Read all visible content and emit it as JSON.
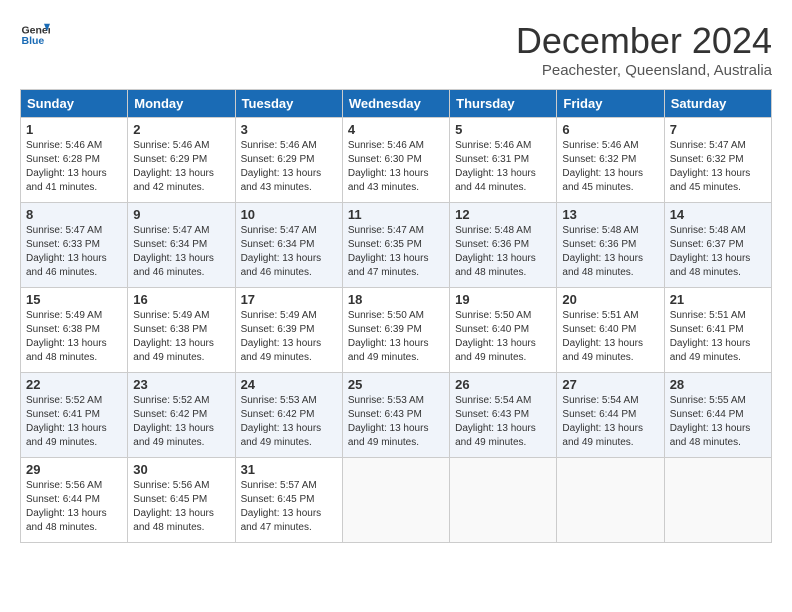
{
  "header": {
    "logo_line1": "General",
    "logo_line2": "Blue",
    "title": "December 2024",
    "location": "Peachester, Queensland, Australia"
  },
  "weekdays": [
    "Sunday",
    "Monday",
    "Tuesday",
    "Wednesday",
    "Thursday",
    "Friday",
    "Saturday"
  ],
  "weeks": [
    [
      {
        "day": "1",
        "sunrise": "5:46 AM",
        "sunset": "6:28 PM",
        "daylight": "13 hours and 41 minutes."
      },
      {
        "day": "2",
        "sunrise": "5:46 AM",
        "sunset": "6:29 PM",
        "daylight": "13 hours and 42 minutes."
      },
      {
        "day": "3",
        "sunrise": "5:46 AM",
        "sunset": "6:29 PM",
        "daylight": "13 hours and 43 minutes."
      },
      {
        "day": "4",
        "sunrise": "5:46 AM",
        "sunset": "6:30 PM",
        "daylight": "13 hours and 43 minutes."
      },
      {
        "day": "5",
        "sunrise": "5:46 AM",
        "sunset": "6:31 PM",
        "daylight": "13 hours and 44 minutes."
      },
      {
        "day": "6",
        "sunrise": "5:46 AM",
        "sunset": "6:32 PM",
        "daylight": "13 hours and 45 minutes."
      },
      {
        "day": "7",
        "sunrise": "5:47 AM",
        "sunset": "6:32 PM",
        "daylight": "13 hours and 45 minutes."
      }
    ],
    [
      {
        "day": "8",
        "sunrise": "5:47 AM",
        "sunset": "6:33 PM",
        "daylight": "13 hours and 46 minutes."
      },
      {
        "day": "9",
        "sunrise": "5:47 AM",
        "sunset": "6:34 PM",
        "daylight": "13 hours and 46 minutes."
      },
      {
        "day": "10",
        "sunrise": "5:47 AM",
        "sunset": "6:34 PM",
        "daylight": "13 hours and 46 minutes."
      },
      {
        "day": "11",
        "sunrise": "5:47 AM",
        "sunset": "6:35 PM",
        "daylight": "13 hours and 47 minutes."
      },
      {
        "day": "12",
        "sunrise": "5:48 AM",
        "sunset": "6:36 PM",
        "daylight": "13 hours and 48 minutes."
      },
      {
        "day": "13",
        "sunrise": "5:48 AM",
        "sunset": "6:36 PM",
        "daylight": "13 hours and 48 minutes."
      },
      {
        "day": "14",
        "sunrise": "5:48 AM",
        "sunset": "6:37 PM",
        "daylight": "13 hours and 48 minutes."
      }
    ],
    [
      {
        "day": "15",
        "sunrise": "5:49 AM",
        "sunset": "6:38 PM",
        "daylight": "13 hours and 48 minutes."
      },
      {
        "day": "16",
        "sunrise": "5:49 AM",
        "sunset": "6:38 PM",
        "daylight": "13 hours and 49 minutes."
      },
      {
        "day": "17",
        "sunrise": "5:49 AM",
        "sunset": "6:39 PM",
        "daylight": "13 hours and 49 minutes."
      },
      {
        "day": "18",
        "sunrise": "5:50 AM",
        "sunset": "6:39 PM",
        "daylight": "13 hours and 49 minutes."
      },
      {
        "day": "19",
        "sunrise": "5:50 AM",
        "sunset": "6:40 PM",
        "daylight": "13 hours and 49 minutes."
      },
      {
        "day": "20",
        "sunrise": "5:51 AM",
        "sunset": "6:40 PM",
        "daylight": "13 hours and 49 minutes."
      },
      {
        "day": "21",
        "sunrise": "5:51 AM",
        "sunset": "6:41 PM",
        "daylight": "13 hours and 49 minutes."
      }
    ],
    [
      {
        "day": "22",
        "sunrise": "5:52 AM",
        "sunset": "6:41 PM",
        "daylight": "13 hours and 49 minutes."
      },
      {
        "day": "23",
        "sunrise": "5:52 AM",
        "sunset": "6:42 PM",
        "daylight": "13 hours and 49 minutes."
      },
      {
        "day": "24",
        "sunrise": "5:53 AM",
        "sunset": "6:42 PM",
        "daylight": "13 hours and 49 minutes."
      },
      {
        "day": "25",
        "sunrise": "5:53 AM",
        "sunset": "6:43 PM",
        "daylight": "13 hours and 49 minutes."
      },
      {
        "day": "26",
        "sunrise": "5:54 AM",
        "sunset": "6:43 PM",
        "daylight": "13 hours and 49 minutes."
      },
      {
        "day": "27",
        "sunrise": "5:54 AM",
        "sunset": "6:44 PM",
        "daylight": "13 hours and 49 minutes."
      },
      {
        "day": "28",
        "sunrise": "5:55 AM",
        "sunset": "6:44 PM",
        "daylight": "13 hours and 48 minutes."
      }
    ],
    [
      {
        "day": "29",
        "sunrise": "5:56 AM",
        "sunset": "6:44 PM",
        "daylight": "13 hours and 48 minutes."
      },
      {
        "day": "30",
        "sunrise": "5:56 AM",
        "sunset": "6:45 PM",
        "daylight": "13 hours and 48 minutes."
      },
      {
        "day": "31",
        "sunrise": "5:57 AM",
        "sunset": "6:45 PM",
        "daylight": "13 hours and 47 minutes."
      },
      null,
      null,
      null,
      null
    ]
  ]
}
